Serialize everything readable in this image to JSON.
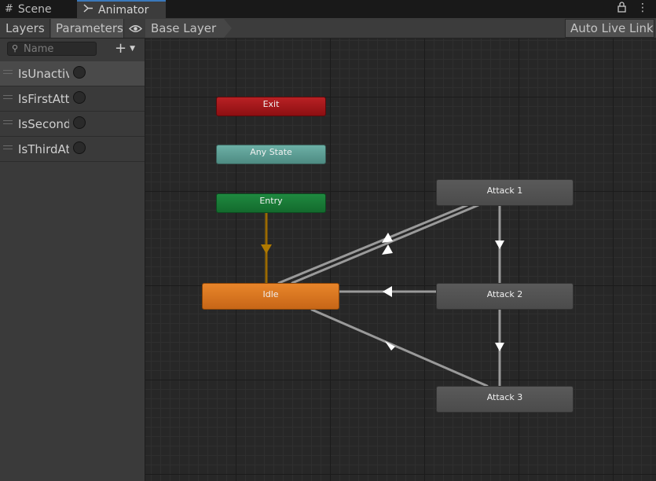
{
  "tabs": [
    {
      "label": "Scene",
      "icon": "grid-icon"
    },
    {
      "label": "Animator",
      "icon": "animator-icon"
    }
  ],
  "window_icons": [
    "lock-icon",
    "more-menu-icon"
  ],
  "toolbar": {
    "layers_label": "Layers",
    "parameters_label": "Parameters",
    "breadcrumb": "Base Layer",
    "auto_live_link": "Auto Live Link"
  },
  "sidebar": {
    "search_placeholder": "Name",
    "params": [
      {
        "name": "IsUnactive",
        "type": "bool",
        "value": false
      },
      {
        "name": "IsFirstAttack",
        "type": "bool",
        "value": false
      },
      {
        "name": "IsSecondAttack",
        "type": "bool",
        "value": false
      },
      {
        "name": "IsThirdAttack",
        "type": "bool",
        "value": false
      }
    ]
  },
  "graph": {
    "states": {
      "exit": "Exit",
      "any_state": "Any State",
      "entry": "Entry",
      "idle": "Idle",
      "attack1": "Attack 1",
      "attack2": "Attack 2",
      "attack3": "Attack 3"
    },
    "colors": {
      "exit": "#b01b1e",
      "any_state": "#5e9f95",
      "entry": "#1a7d39",
      "idle": "#de7a22",
      "state": "#535353",
      "transition": "#9a9a9a",
      "entry_transition": "#9a6a00"
    }
  }
}
